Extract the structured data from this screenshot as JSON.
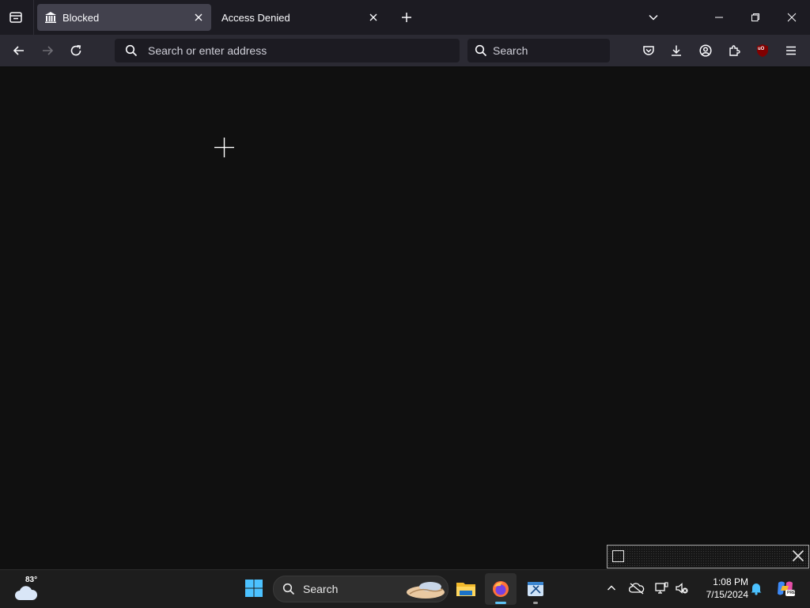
{
  "browser": {
    "tabs": [
      {
        "label": "Blocked",
        "active": true
      },
      {
        "label": "Access Denied",
        "active": false
      }
    ],
    "urlbar": {
      "placeholder": "Search or enter address",
      "value": ""
    },
    "searchbar": {
      "placeholder": "Search",
      "value": ""
    },
    "toolbar_icons": [
      "pocket-icon",
      "download-icon",
      "account-icon",
      "extensions-icon",
      "ublock-icon",
      "menu-icon"
    ],
    "ublock_badge": "uO"
  },
  "taskbar": {
    "weather": {
      "temp": "83°",
      "icon": "cloud-icon"
    },
    "search_label": "Search",
    "apps": [
      "file-explorer-icon",
      "firefox-icon",
      "snipping-tool-icon"
    ],
    "clock": {
      "time": "1:08 PM",
      "date": "7/15/2024"
    }
  },
  "colors": {
    "tabstrip": "#1c1b22",
    "navbar": "#2b2a33",
    "content": "#101010",
    "taskbar": "#1d1d1d",
    "accent": "#5ec3f5"
  }
}
